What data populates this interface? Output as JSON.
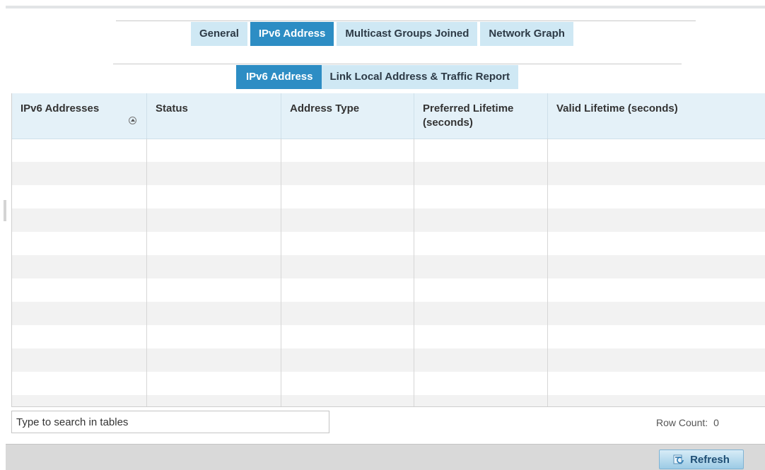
{
  "top_tabs": [
    {
      "label": "General",
      "active": false
    },
    {
      "label": "IPv6 Address",
      "active": true
    },
    {
      "label": "Multicast Groups Joined",
      "active": false
    },
    {
      "label": "Network Graph",
      "active": false
    }
  ],
  "sub_tabs": [
    {
      "label": "IPv6 Address",
      "active": true
    },
    {
      "label": "Link Local Address & Traffic Report",
      "active": false
    }
  ],
  "table": {
    "columns": [
      {
        "label": "IPv6 Addresses",
        "sortable": true
      },
      {
        "label": "Status"
      },
      {
        "label": "Address Type"
      },
      {
        "label": "Preferred Lifetime (seconds)"
      },
      {
        "label": "Valid Lifetime (seconds)"
      }
    ],
    "rows": []
  },
  "search": {
    "placeholder": "Type to search in tables",
    "value": ""
  },
  "row_count": {
    "label": "Row Count:",
    "value": "0"
  },
  "footer": {
    "refresh_label": "Refresh"
  },
  "icons": {
    "sort": "sort-ascending-icon",
    "refresh": "refresh-icon"
  },
  "colors": {
    "accent": "#2d8dc4",
    "tab_inactive": "#cfe8f4",
    "header_bg": "#e4f1f8"
  }
}
